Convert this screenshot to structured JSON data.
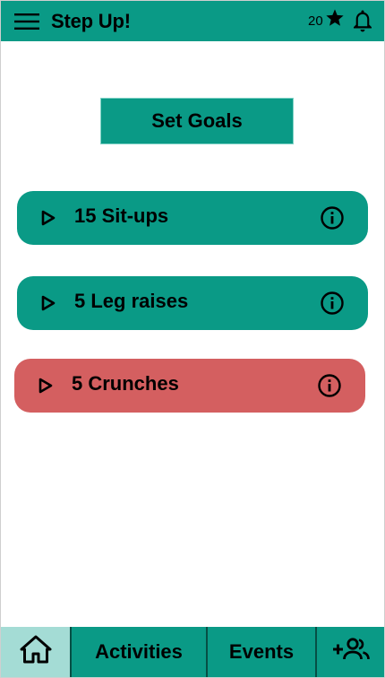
{
  "header": {
    "title": "Step Up!",
    "star_count": "20",
    "menu_icon": "hamburger-menu-icon",
    "star_icon": "star-icon",
    "bell_icon": "bell-icon"
  },
  "main": {
    "set_goals_label": "Set Goals",
    "exercises": [
      {
        "label": "15 Sit-ups",
        "color": "#0a9a86",
        "status": "active"
      },
      {
        "label": "5 Leg raises",
        "color": "#0a9a86",
        "status": "active"
      },
      {
        "label": "5 Crunches",
        "color": "#d45f60",
        "status": "highlighted"
      }
    ]
  },
  "bottom_nav": {
    "home_icon": "home-icon",
    "activities_label": "Activities",
    "events_label": "Events",
    "add_friend_icon": "add-friend-icon",
    "active_tab": "home"
  },
  "colors": {
    "primary": "#0a9a86",
    "alert": "#d45f60",
    "active_tab": "#a4dcd5"
  }
}
